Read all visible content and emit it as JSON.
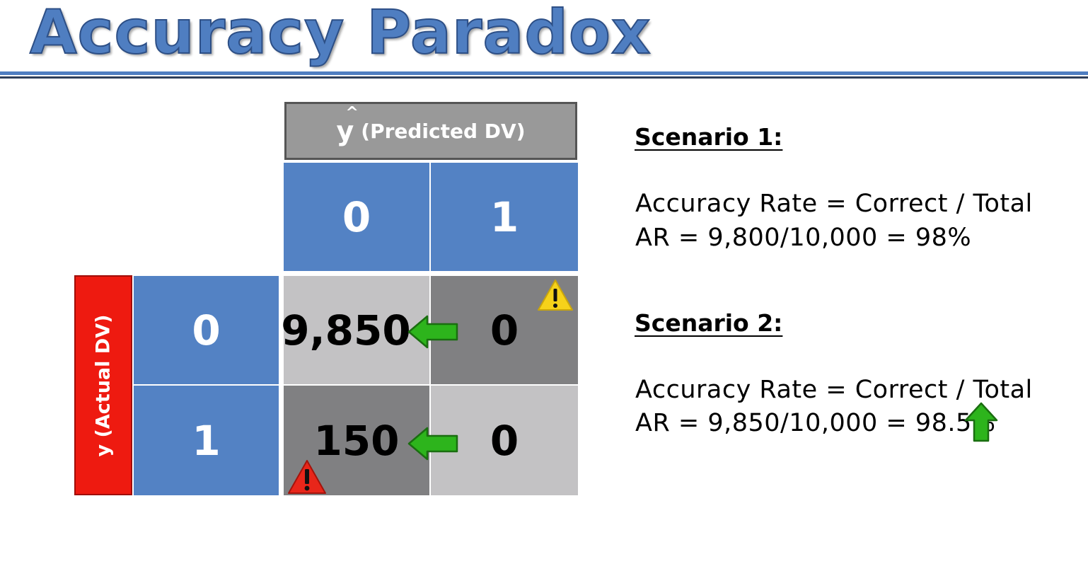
{
  "slide": {
    "title": "Accuracy Paradox"
  },
  "matrix": {
    "predicted_header": {
      "symbol": "y",
      "label": "(Predicted DV)"
    },
    "actual_header": {
      "label": "y (Actual DV)"
    },
    "predicted_classes": [
      "0",
      "1"
    ],
    "actual_classes": [
      "0",
      "1"
    ],
    "cells": [
      [
        "9,850",
        "0"
      ],
      [
        "150",
        "0"
      ]
    ]
  },
  "scenarios": [
    {
      "title": "Scenario 1:",
      "formula": "Accuracy Rate = Correct / Total",
      "result": "AR = 9,800/10,000 = 98%"
    },
    {
      "title": "Scenario 2:",
      "formula": "Accuracy Rate = Correct / Total",
      "result": "AR = 9,850/10,000 = 98.5%"
    }
  ],
  "colors": {
    "title_blue": "#4f7ec1",
    "cell_blue": "#5382c4",
    "cell_light_gray": "#c3c2c4",
    "cell_dark_gray": "#808082",
    "actual_header_red": "#ee1a10",
    "arrow_green": "#2db41c",
    "warning_yellow": "#f6d21a",
    "warning_red": "#e8261a"
  },
  "icons": {
    "move_arrows": "green-left-arrow-icon",
    "increase_arrow": "green-up-arrow-icon",
    "warnings": [
      "yellow-warning-icon",
      "red-warning-icon"
    ]
  }
}
